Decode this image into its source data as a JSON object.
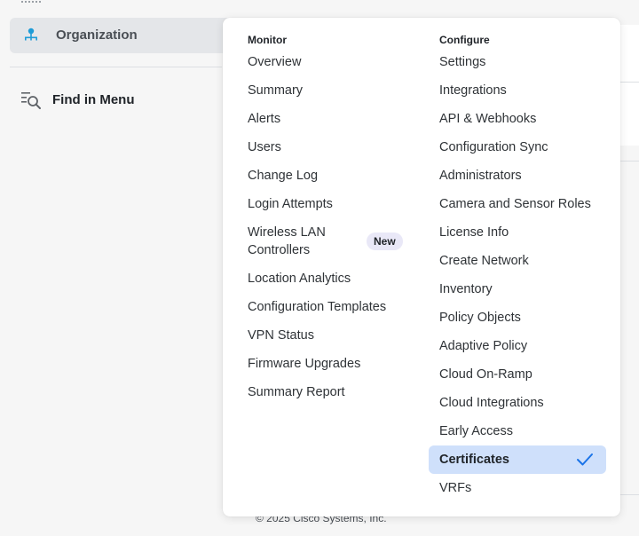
{
  "sidebar": {
    "organization_label": "Organization",
    "find_label": "Find in Menu"
  },
  "menu": {
    "monitor": {
      "header": "Monitor",
      "items": [
        {
          "label": "Overview"
        },
        {
          "label": "Summary"
        },
        {
          "label": "Alerts"
        },
        {
          "label": "Users"
        },
        {
          "label": "Change Log"
        },
        {
          "label": "Login Attempts"
        },
        {
          "label": "Wireless LAN Controllers",
          "badge": "New"
        },
        {
          "label": "Location Analytics"
        },
        {
          "label": "Configuration Templates"
        },
        {
          "label": "VPN Status"
        },
        {
          "label": "Firmware Upgrades"
        },
        {
          "label": "Summary Report"
        }
      ]
    },
    "configure": {
      "header": "Configure",
      "items": [
        {
          "label": "Settings"
        },
        {
          "label": "Integrations"
        },
        {
          "label": "API & Webhooks"
        },
        {
          "label": "Configuration Sync"
        },
        {
          "label": "Administrators"
        },
        {
          "label": "Camera and Sensor Roles"
        },
        {
          "label": "License Info"
        },
        {
          "label": "Create Network"
        },
        {
          "label": "Inventory"
        },
        {
          "label": "Policy Objects"
        },
        {
          "label": "Adaptive Policy"
        },
        {
          "label": "Cloud On-Ramp"
        },
        {
          "label": "Cloud Integrations"
        },
        {
          "label": "Early Access"
        },
        {
          "label": "Certificates",
          "selected": true
        },
        {
          "label": "VRFs"
        }
      ]
    }
  },
  "footer": {
    "copyright": "© 2025 Cisco Systems, Inc."
  },
  "colors": {
    "accent": "#1a73e8",
    "selected_bg": "#cfe0fb",
    "org_icon": "#1e9cd7",
    "badge_bg": "#e9e8f7"
  },
  "icons": {
    "organization": "organization-icon",
    "find": "find-in-menu-icon",
    "selected": "check-icon"
  }
}
